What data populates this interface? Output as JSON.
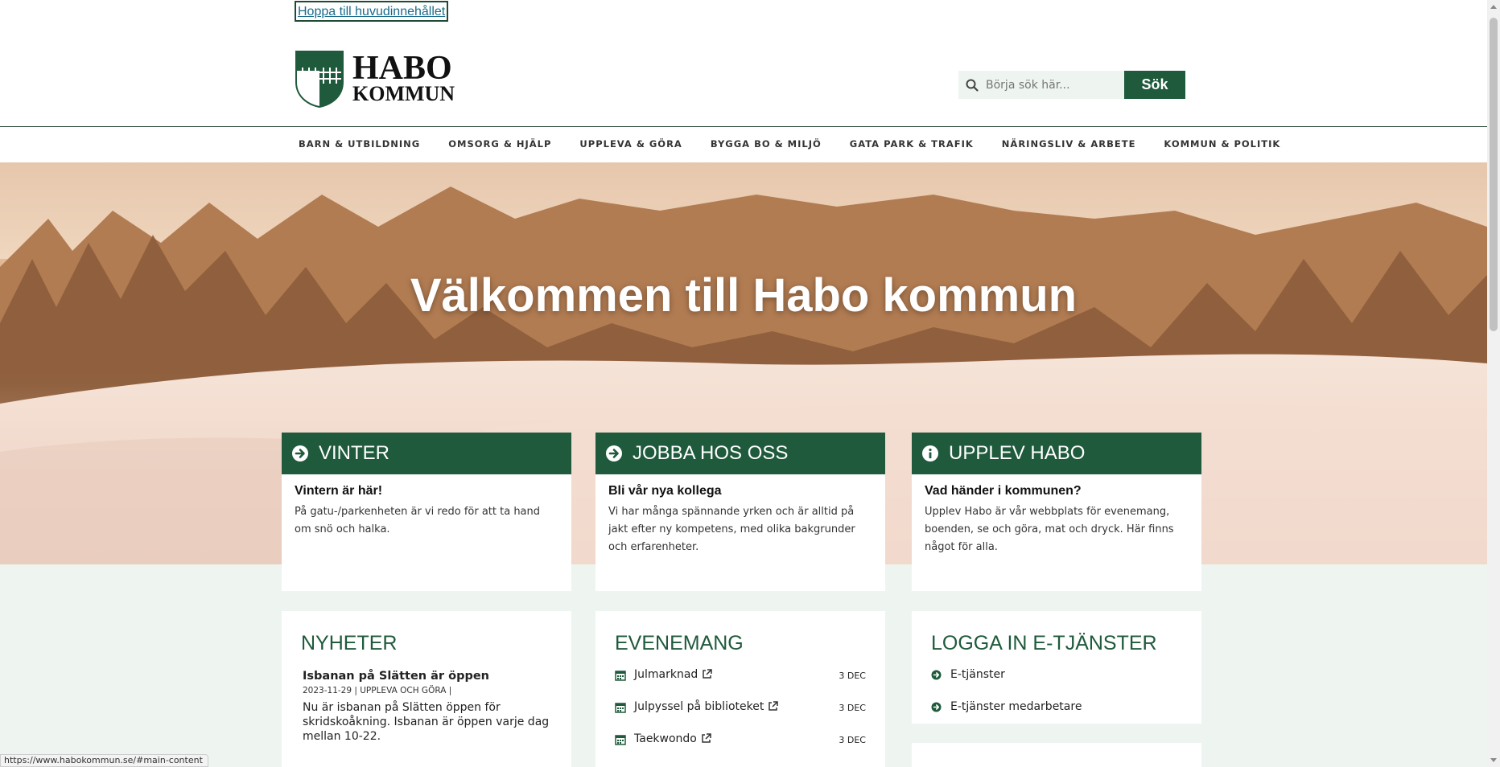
{
  "skip_link": "Hoppa till huvudinnehållet",
  "logo": {
    "line1": "HABO",
    "line2": "KOMMUN"
  },
  "search": {
    "placeholder": "Börja sök här...",
    "button": "Sök"
  },
  "nav": [
    "BARN & UTBILDNING",
    "OMSORG & HJÄLP",
    "UPPLEVA & GÖRA",
    "BYGGA BO & MILJÖ",
    "GATA PARK & TRAFIK",
    "NÄRINGSLIV & ARBETE",
    "KOMMUN & POLITIK"
  ],
  "hero": {
    "title": "Välkommen till Habo kommun"
  },
  "cards": [
    {
      "icon": "arrow-circle-right-icon",
      "title": "VINTER",
      "subtitle": "Vintern är här!",
      "body": "På gatu-/parkenheten är vi redo för att ta hand om snö och halka."
    },
    {
      "icon": "arrow-circle-right-icon",
      "title": "JOBBA HOS OSS",
      "subtitle": "Bli vår nya kollega",
      "body": "Vi har många spännande yrken och är alltid på jakt efter ny kompetens, med olika bakgrunder och erfarenheter."
    },
    {
      "icon": "info-circle-icon",
      "title": "UPPLEV HABO",
      "subtitle": "Vad händer i kommunen?",
      "body": "Upplev Habo är vår webbplats för evenemang, boenden, se och göra, mat och dryck. Här finns något för alla."
    }
  ],
  "news": {
    "heading": "NYHETER",
    "items": [
      {
        "title": "Isbanan på Slätten är öppen",
        "meta": "2023-11-29 | UPPLEVA OCH GÖRA |",
        "text": "Nu är isbanan på Slätten öppen för skridskoåkning. Isbanan är öppen varje dag mellan 10-22."
      }
    ]
  },
  "events": {
    "heading": "EVENEMANG",
    "items": [
      {
        "title": "Julmarknad",
        "date": "3 DEC"
      },
      {
        "title": "Julpyssel på biblioteket",
        "date": "3 DEC"
      },
      {
        "title": "Taekwondo",
        "date": "3 DEC"
      }
    ]
  },
  "login": {
    "heading": "LOGGA IN E-TJÄNSTER",
    "items": [
      "E-tjänster",
      "E-tjänster medarbetare"
    ]
  },
  "status_url": "https://www.habokommun.se/#main-content",
  "colors": {
    "brand_green": "#1f5a3c",
    "background": "#eef5f0"
  }
}
